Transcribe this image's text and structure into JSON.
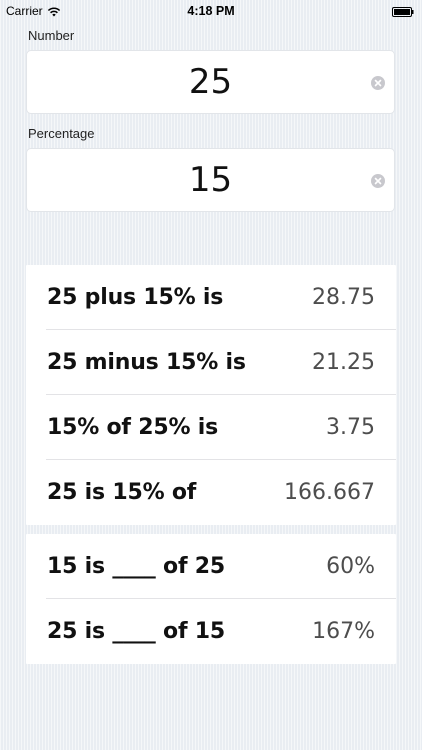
{
  "status_bar": {
    "carrier": "Carrier",
    "time": "4:18 PM"
  },
  "number_field": {
    "label": "Number",
    "value": "25"
  },
  "percentage_field": {
    "label": "Percentage",
    "value": "15"
  },
  "results": [
    {
      "label": "25 plus 15% is",
      "value": "28.75"
    },
    {
      "label": "25 minus 15% is",
      "value": "21.25"
    },
    {
      "label": "15% of 25% is",
      "value": "3.75"
    },
    {
      "label": "25 is 15% of",
      "value": "166.667"
    }
  ],
  "ratio_results": [
    {
      "label": "15 is ____ of 25",
      "value": "60%"
    },
    {
      "label": "25 is ____ of 15",
      "value": "167%"
    }
  ],
  "colors": {
    "background": "#e9edf2",
    "card": "#ffffff",
    "value_text": "#4d4d4d"
  }
}
